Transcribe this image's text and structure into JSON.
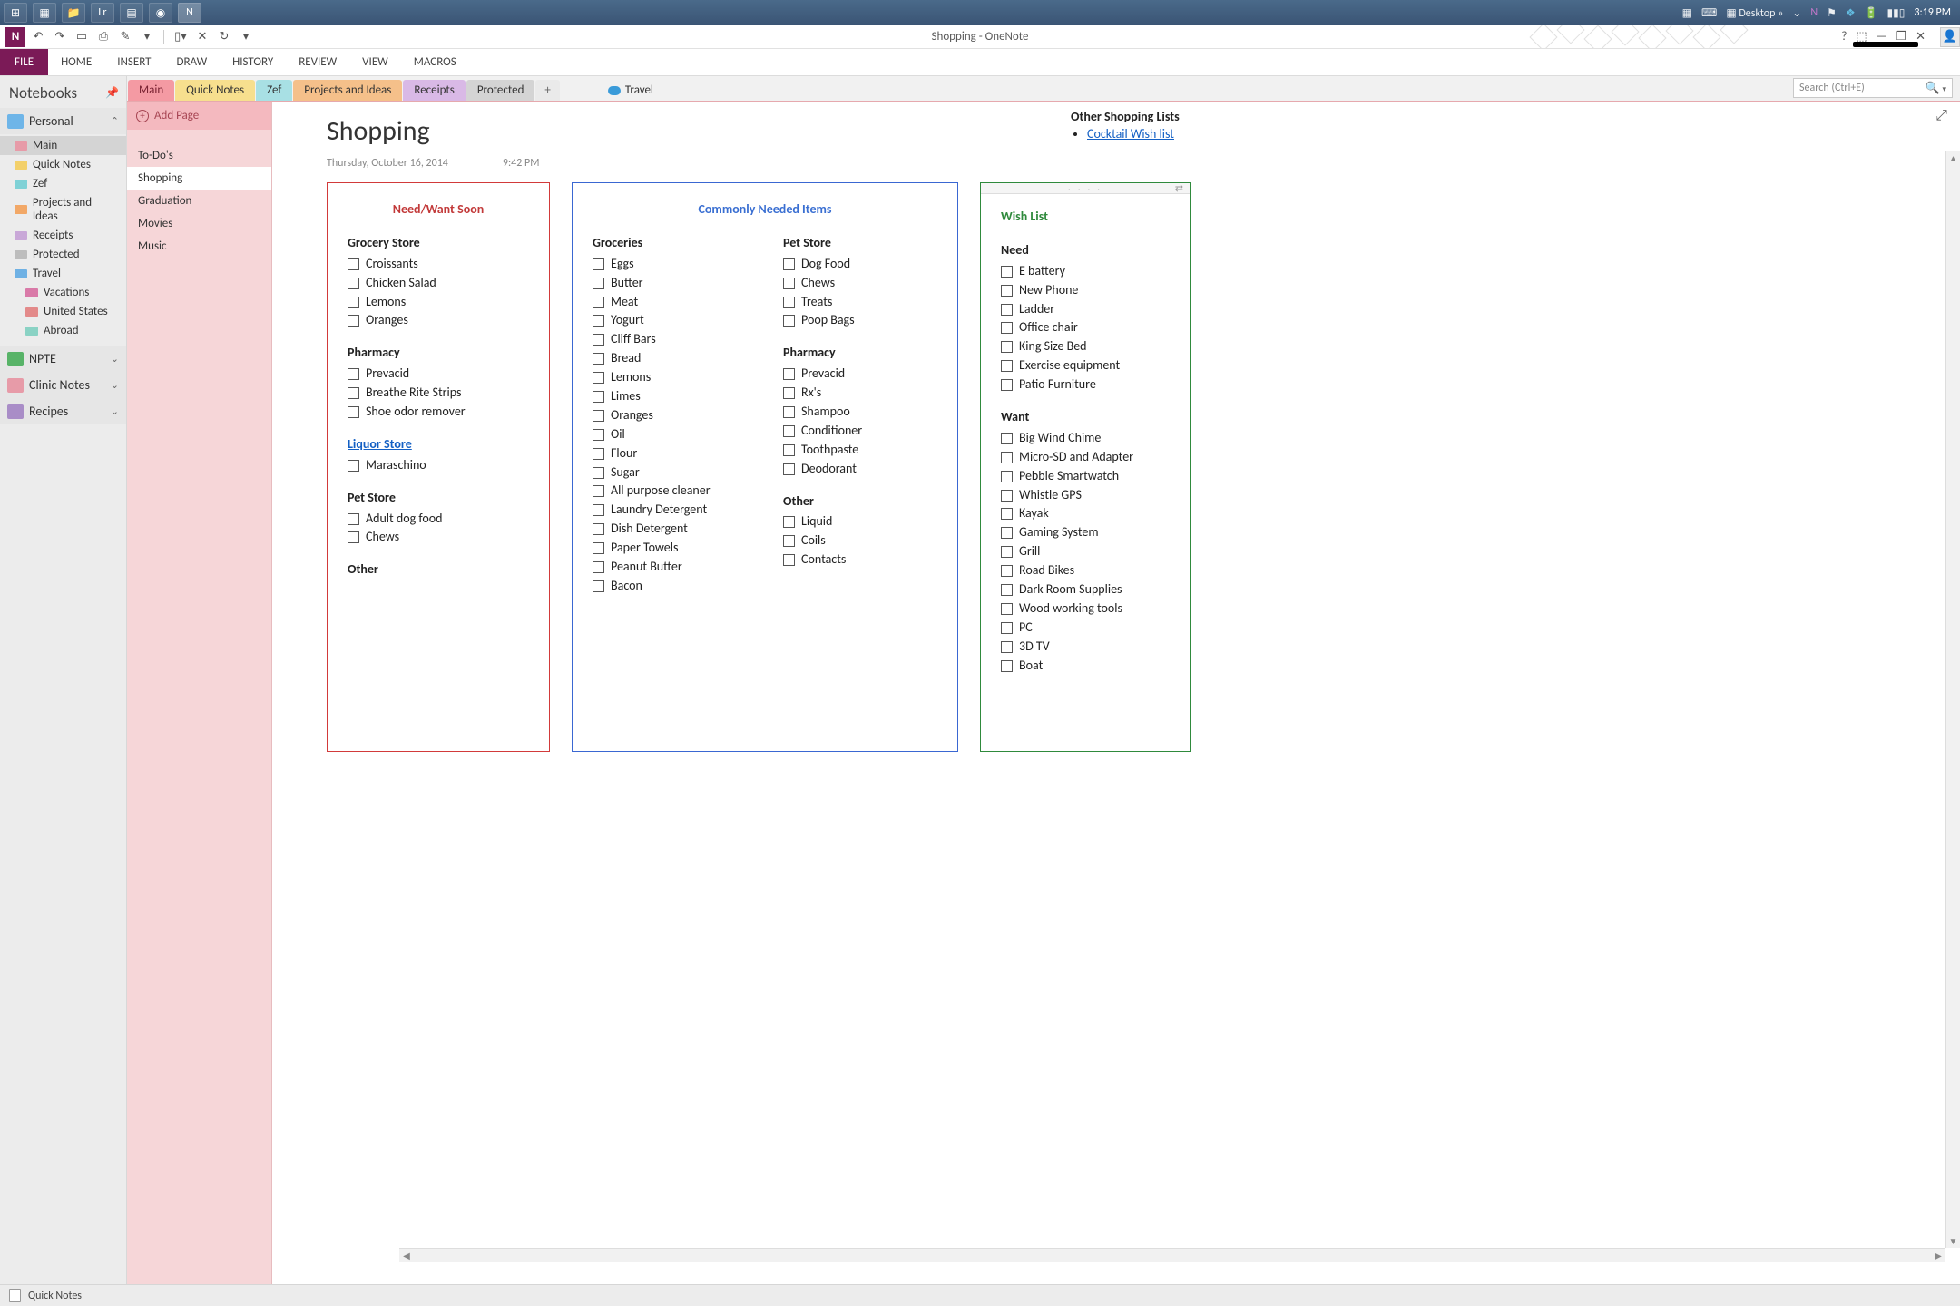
{
  "taskbar": {
    "apps": [
      "win",
      "grid",
      "folder",
      "lr",
      "note1",
      "chrome",
      "onenote"
    ],
    "desktop_label": "Desktop",
    "clock": "3:19 PM"
  },
  "window": {
    "title": "Shopping - OneNote"
  },
  "ribbon": {
    "file": "FILE",
    "tabs": [
      "HOME",
      "INSERT",
      "DRAW",
      "HISTORY",
      "REVIEW",
      "VIEW",
      "MACROS"
    ]
  },
  "notebook_panel": {
    "header": "Notebooks",
    "notebooks": [
      {
        "name": "Personal",
        "color": "blue",
        "expanded": true,
        "sections": [
          {
            "label": "Main",
            "color": "ti-pink",
            "selected": true
          },
          {
            "label": "Quick Notes",
            "color": "ti-yellow"
          },
          {
            "label": "Zef",
            "color": "ti-teal"
          },
          {
            "label": "Projects and Ideas",
            "color": "ti-orange"
          },
          {
            "label": "Receipts",
            "color": "ti-lilac"
          },
          {
            "label": "Protected",
            "color": "ti-grey"
          },
          {
            "label": "Travel",
            "color": "ti-blue",
            "children": [
              {
                "label": "Vacations",
                "color": "ti-mag"
              },
              {
                "label": "United States",
                "color": "ti-red"
              },
              {
                "label": "Abroad",
                "color": "ti-teal2"
              }
            ]
          }
        ]
      },
      {
        "name": "NPTE",
        "color": "green",
        "expanded": false
      },
      {
        "name": "Clinic Notes",
        "color": "pink",
        "expanded": false
      },
      {
        "name": "Recipes",
        "color": "purple",
        "expanded": false
      }
    ]
  },
  "section_tabs": {
    "tabs": [
      {
        "label": "Main",
        "cls": "main"
      },
      {
        "label": "Quick Notes",
        "cls": "qn"
      },
      {
        "label": "Zef",
        "cls": "zef"
      },
      {
        "label": "Projects and Ideas",
        "cls": "proj"
      },
      {
        "label": "Receipts",
        "cls": "rec"
      },
      {
        "label": "Protected",
        "cls": "prot"
      }
    ],
    "add": "+",
    "travel": "Travel",
    "search_placeholder": "Search (Ctrl+E)"
  },
  "pages_pane": {
    "add_label": "Add Page",
    "pages": [
      "To-Do's",
      "Shopping",
      "Graduation",
      "Movies",
      "Music"
    ],
    "selected": "Shopping"
  },
  "page": {
    "title": "Shopping",
    "date": "Thursday, October 16, 2014",
    "time": "9:42 PM",
    "other_heading": "Other Shopping Lists",
    "other_links": [
      "Cocktail Wish list"
    ]
  },
  "box_red": {
    "title": "Need/Want Soon",
    "sections": [
      {
        "heading": "Grocery Store",
        "items": [
          "Croissants",
          "Chicken Salad",
          "Lemons",
          "Oranges"
        ]
      },
      {
        "heading": "Pharmacy",
        "items": [
          "Prevacid",
          "Breathe Rite Strips",
          "Shoe odor remover"
        ]
      },
      {
        "heading": "Liquor Store",
        "link": true,
        "items": [
          "Maraschino"
        ]
      },
      {
        "heading": "Pet Store",
        "items": [
          "Adult dog food",
          "Chews"
        ]
      },
      {
        "heading": "Other",
        "items": []
      }
    ]
  },
  "box_blue": {
    "title": "Commonly Needed Items",
    "left": [
      {
        "heading": "Groceries",
        "items": [
          "Eggs",
          "Butter",
          "Meat",
          "Yogurt",
          "Cliff Bars",
          "Bread",
          "Lemons",
          "Limes",
          "Oranges",
          "Oil",
          "Flour",
          "Sugar",
          "All purpose cleaner",
          "Laundry Detergent",
          "Dish Detergent",
          "Paper Towels",
          "Peanut Butter",
          "Bacon"
        ]
      }
    ],
    "right": [
      {
        "heading": "Pet Store",
        "items": [
          "Dog Food",
          "Chews",
          "Treats",
          "Poop Bags"
        ]
      },
      {
        "heading": "Pharmacy",
        "items": [
          "Prevacid",
          "Rx's",
          "Shampoo",
          "Conditioner",
          "Toothpaste",
          "Deodorant"
        ]
      },
      {
        "heading": "Other",
        "items": [
          "Liquid",
          "Coils",
          "Contacts"
        ]
      }
    ]
  },
  "box_green": {
    "title": "Wish List",
    "sections": [
      {
        "heading": "Need",
        "items": [
          "E battery",
          "New Phone",
          "Ladder",
          "Office chair",
          "King Size Bed",
          "Exercise equipment",
          "Patio Furniture"
        ]
      },
      {
        "heading": "Want",
        "items": [
          "Big Wind Chime",
          "Micro-SD and Adapter",
          "Pebble Smartwatch",
          "Whistle GPS",
          "Kayak",
          "Gaming System",
          "Grill",
          "Road Bikes",
          "Dark Room Supplies",
          "Wood working tools",
          "PC",
          "3D TV",
          "Boat"
        ]
      }
    ]
  },
  "statusbar": {
    "quick_notes": "Quick Notes"
  }
}
